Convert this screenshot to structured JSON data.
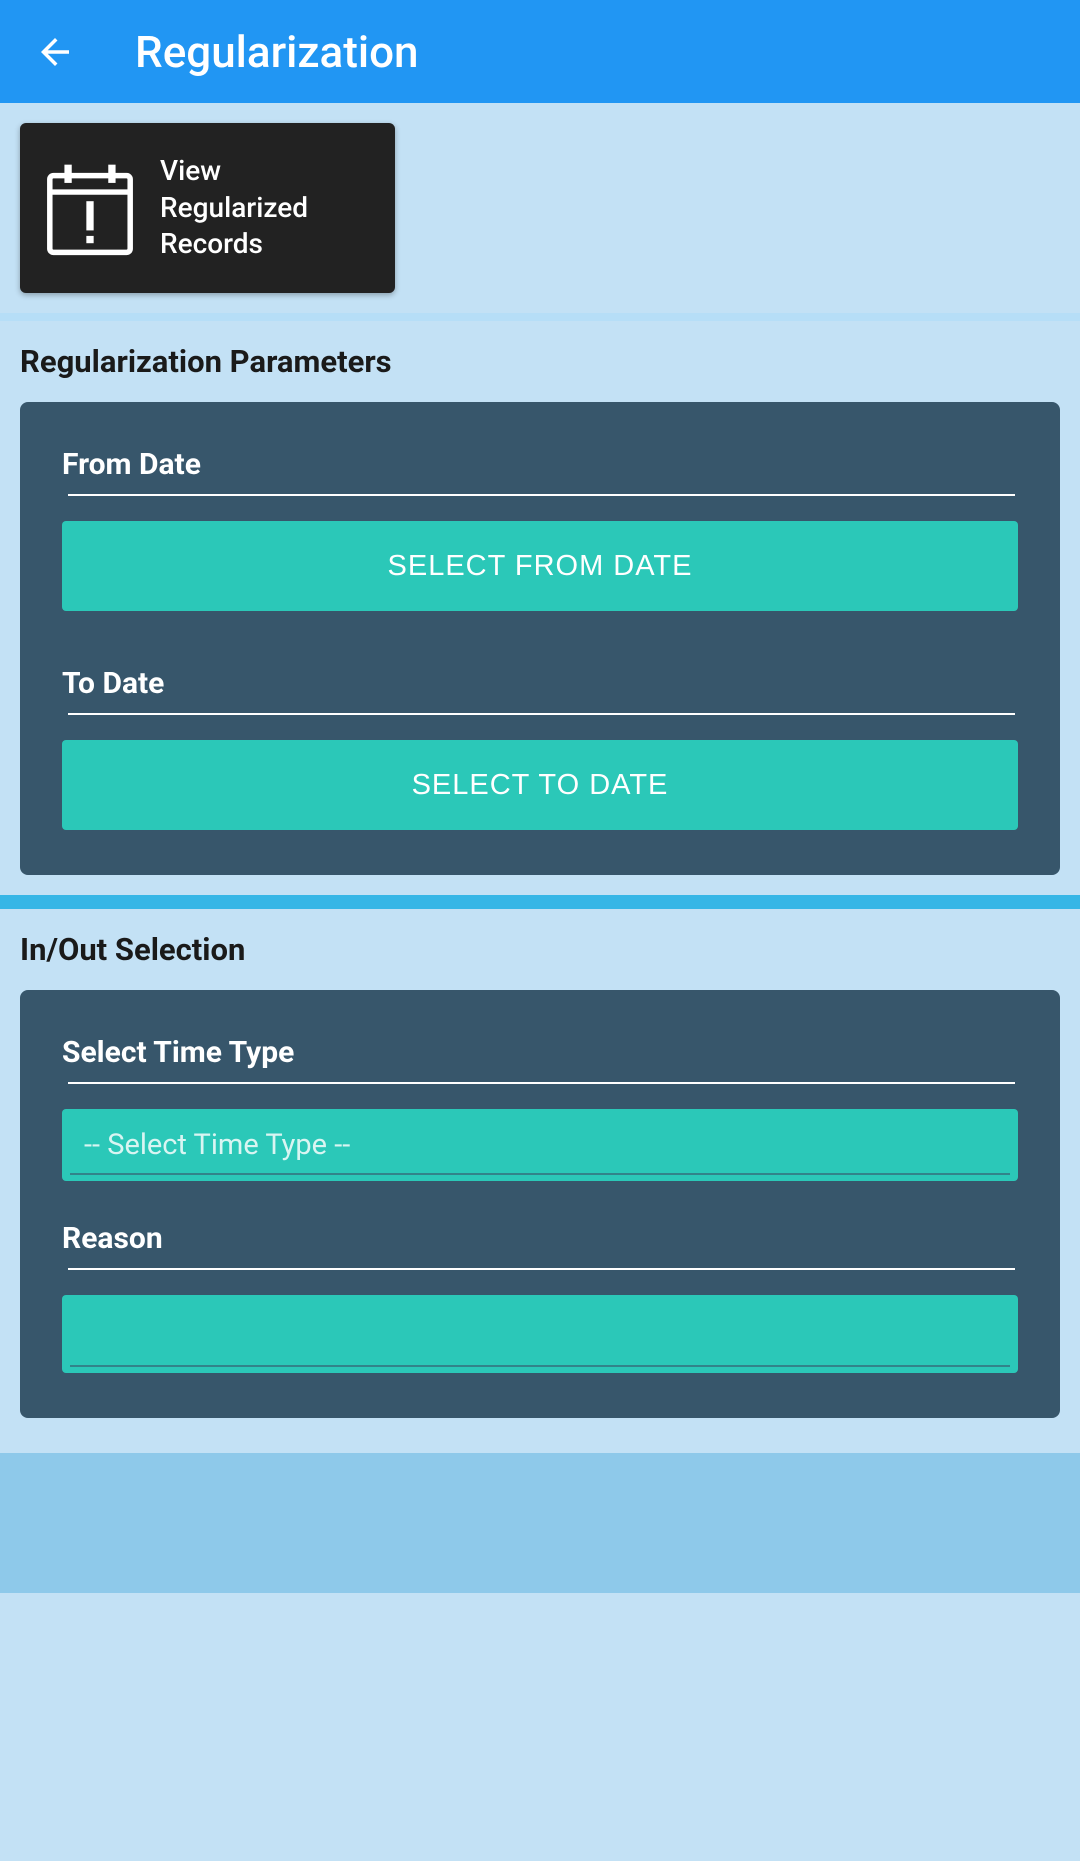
{
  "header": {
    "title": "Regularization"
  },
  "topCard": {
    "label": "View Regularized Records"
  },
  "section1": {
    "heading": "Regularization Parameters",
    "fromLabel": "From Date",
    "fromButton": "SELECT FROM DATE",
    "toLabel": "To Date",
    "toButton": "SELECT TO DATE"
  },
  "section2": {
    "heading": "In/Out Selection",
    "timeTypeLabel": "Select Time Type",
    "timeTypePlaceholder": "-- Select Time Type --",
    "reasonLabel": "Reason"
  }
}
